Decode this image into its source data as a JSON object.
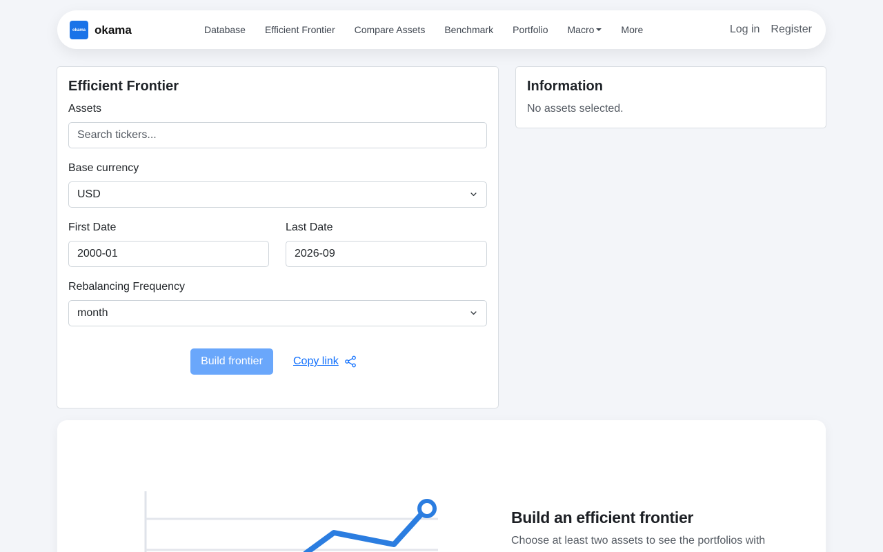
{
  "brand": {
    "logo_text": "okama",
    "name": "okama"
  },
  "nav": {
    "links": [
      "Database",
      "Efficient Frontier",
      "Compare Assets",
      "Benchmark",
      "Portfolio",
      "Macro",
      "More"
    ],
    "login": "Log in",
    "register": "Register"
  },
  "form": {
    "title": "Efficient Frontier",
    "assets_label": "Assets",
    "assets_placeholder": "Search tickers...",
    "currency_label": "Base currency",
    "currency_value": "USD",
    "first_date_label": "First Date",
    "first_date_value": "2000-01",
    "last_date_label": "Last Date",
    "last_date_value": "2026-09",
    "rebalancing_label": "Rebalancing Frequency",
    "rebalancing_value": "month",
    "build_button": "Build frontier",
    "copy_link": "Copy link"
  },
  "info": {
    "title": "Information",
    "text": "No assets selected."
  },
  "hero": {
    "title": "Build an efficient frontier",
    "subtitle": "Choose at least two assets to see the portfolios with"
  },
  "colors": {
    "accent": "#0d6efd",
    "build_button": "#6aa7fb",
    "chart_line": "#2b7de0",
    "background": "#f3f5f9"
  }
}
